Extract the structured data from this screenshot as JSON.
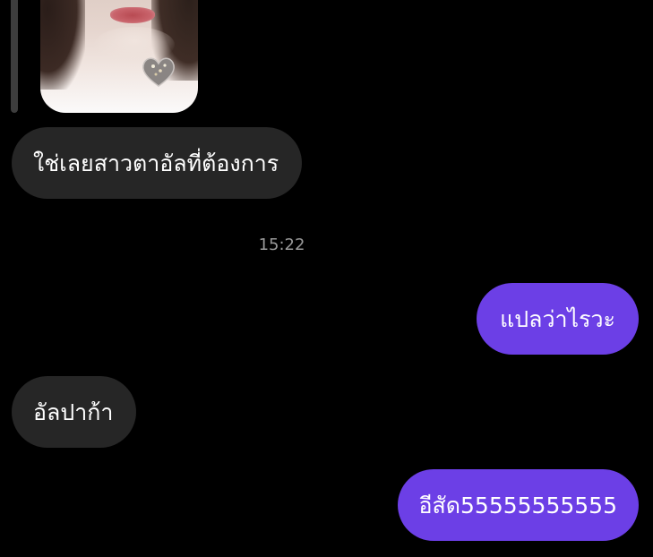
{
  "chat": {
    "shared_photo": {
      "icon": "heart-necklace"
    },
    "messages": [
      {
        "id": "msg1",
        "side": "incoming",
        "text": "ใช่เลยสาวตาอัลที่ต้องการ"
      },
      {
        "id": "msg2",
        "side": "outgoing",
        "text": "แปลว่าไรวะ"
      },
      {
        "id": "msg3",
        "side": "incoming",
        "text": "อัลปาก้า"
      },
      {
        "id": "msg4",
        "side": "outgoing",
        "text": "อีสัด55555555555"
      }
    ],
    "timestamp": "15:22"
  },
  "colors": {
    "background": "#000000",
    "incoming_bubble": "#262626",
    "outgoing_bubble": "#6c3fe6",
    "timestamp_text": "#9a9a9a"
  }
}
